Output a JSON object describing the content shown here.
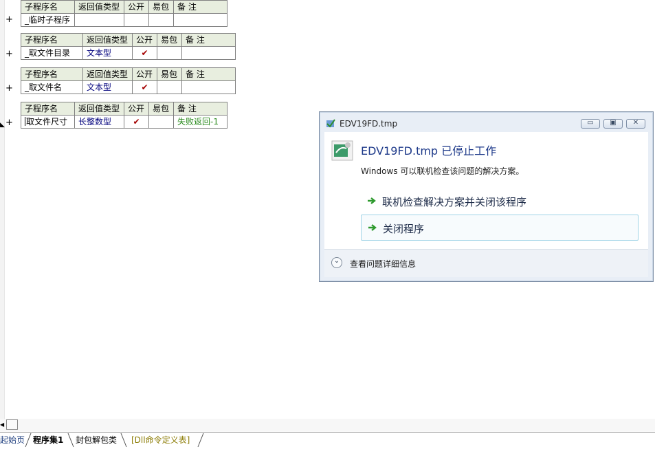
{
  "headers": [
    "子程序名",
    "返回值类型",
    "公开",
    "易包",
    "备 注"
  ],
  "expand_symbol": "+",
  "subs": [
    {
      "name": "_临时子程序",
      "type": "",
      "public": "",
      "easy": "",
      "remark": ""
    },
    {
      "name": "_取文件目录",
      "type": "文本型",
      "public": "✔",
      "easy": "",
      "remark": ""
    },
    {
      "name": "_取文件名",
      "type": "文本型",
      "public": "✔",
      "easy": "",
      "remark": ""
    },
    {
      "name": "取文件尺寸",
      "type": "长整数型",
      "public": "✔",
      "easy": "",
      "remark": "失败返回-1"
    }
  ],
  "dialog": {
    "title": "EDV19FD.tmp",
    "main_message": "EDV19FD.tmp 已停止工作",
    "sub_message": "Windows 可以联机检查该问题的解决方案。",
    "action1": "联机检查解决方案并关闭该程序",
    "action2": "关闭程序",
    "details": "查看问题详细信息",
    "icons": {
      "minimize": "minimize-icon",
      "maximize": "maximize-icon",
      "close": "close-icon"
    }
  },
  "tabs": {
    "t0": "起始页",
    "t1": "程序集1",
    "t2": "封包解包类",
    "t3": "[Dll命令定义表]"
  },
  "colors": {
    "header_bg": "#e8eedf",
    "type_text": "#00007d",
    "check": "#a40000",
    "remark": "#2a8a1e",
    "dialog_title": "#1e3a8a"
  }
}
